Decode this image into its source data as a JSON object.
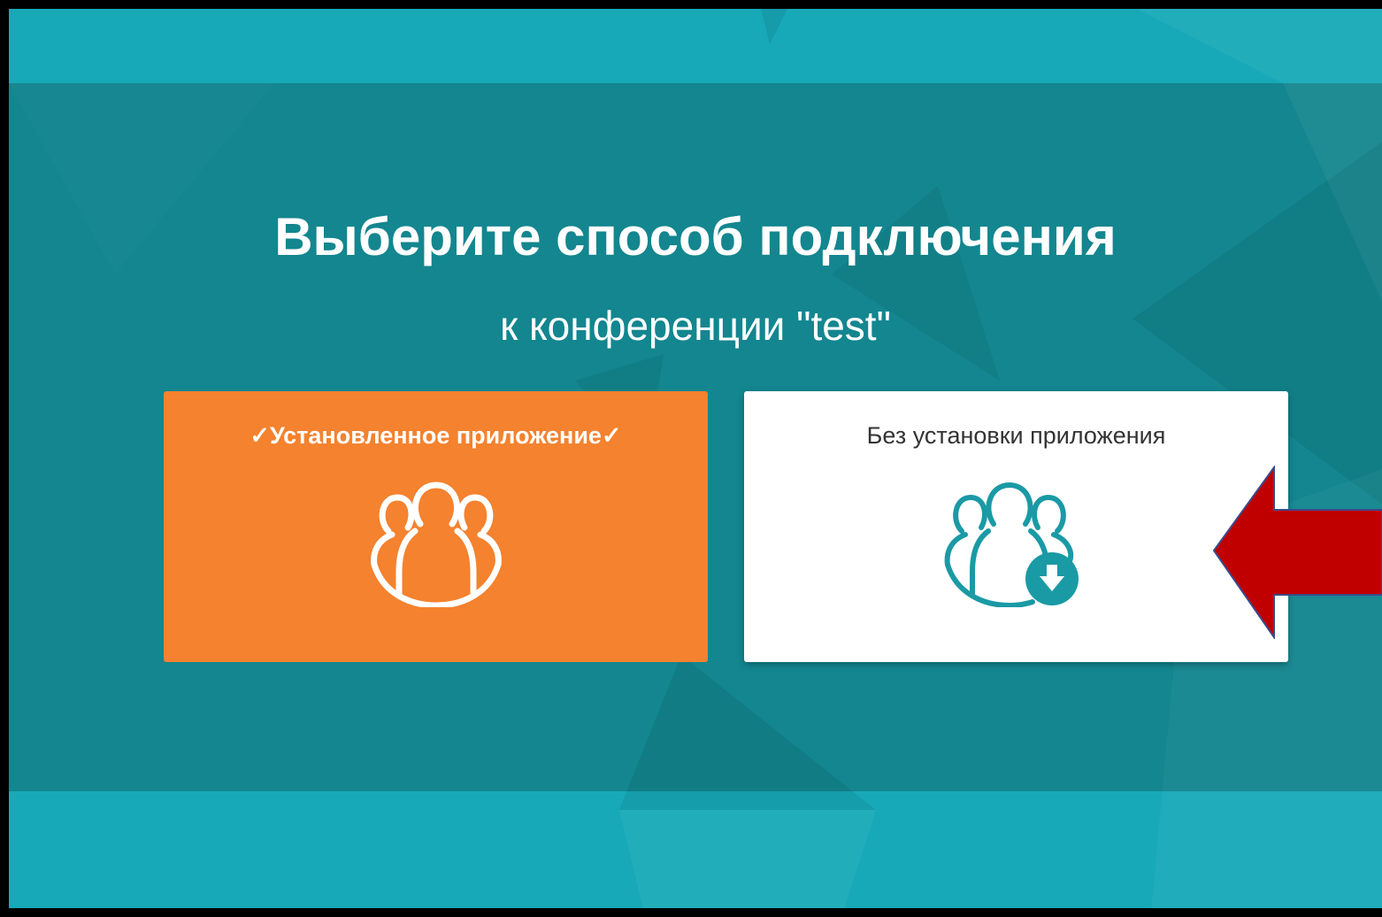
{
  "heading": {
    "title": "Выберите способ подключения",
    "subtitle": "к конференции \"test\""
  },
  "options": [
    {
      "label": "✓Установленное приложение✓",
      "icon": "group-icon",
      "selected": true,
      "color": "#f4822e"
    },
    {
      "label": "Без установки приложения",
      "icon": "group-download-icon",
      "selected": false,
      "color": "#ffffff"
    }
  ],
  "colors": {
    "band_light": "#17a9b8",
    "band_dark": "#13868f",
    "icon_teal": "#1a9aa5",
    "annotation_arrow": "#c00000"
  }
}
